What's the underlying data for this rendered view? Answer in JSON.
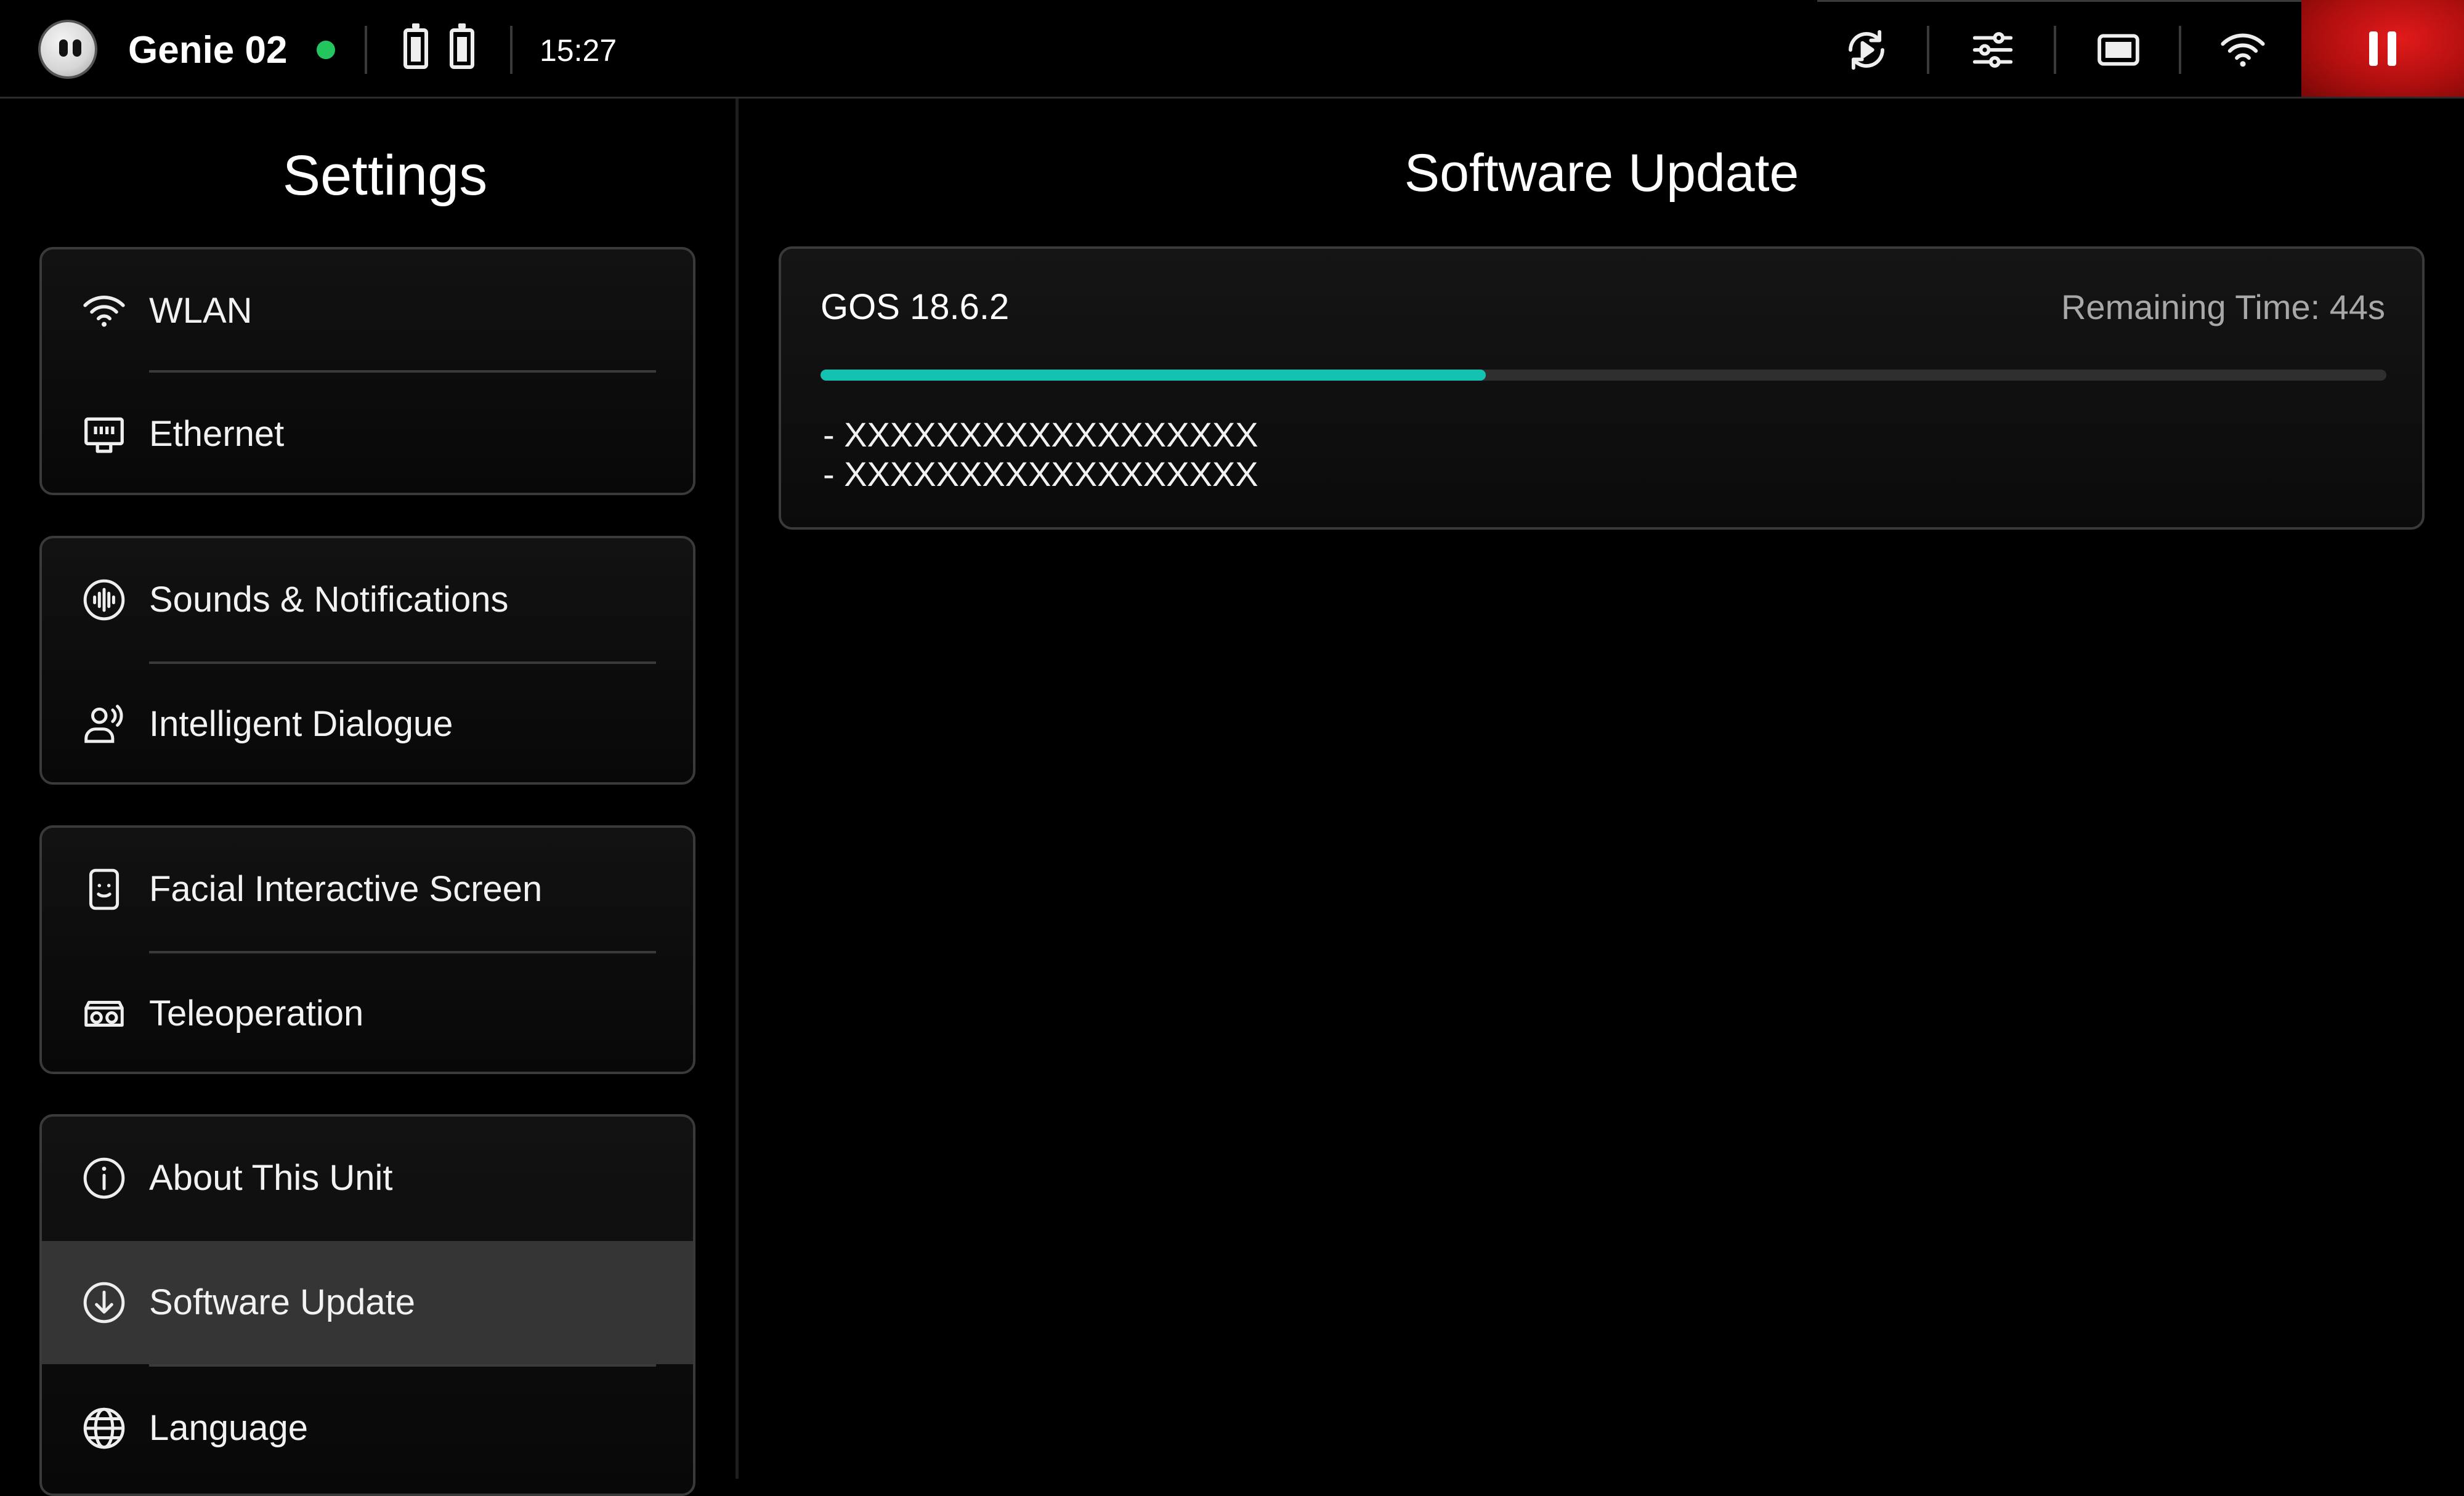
{
  "topbar": {
    "device_name": "Genie 02",
    "time": "15:27",
    "status_color": "#22c55e",
    "icons": [
      "avatar",
      "battery-icon",
      "battery-icon",
      "replay-icon",
      "sliders-icon",
      "screen-icon",
      "wifi-icon",
      "pause-icon"
    ]
  },
  "sidebar": {
    "title": "Settings",
    "groups": [
      {
        "items": [
          {
            "label": "WLAN",
            "icon": "wifi-icon"
          },
          {
            "label": "Ethernet",
            "icon": "ethernet-icon"
          }
        ]
      },
      {
        "items": [
          {
            "label": "Sounds & Notifications",
            "icon": "sound-wave-icon"
          },
          {
            "label": "Intelligent Dialogue",
            "icon": "person-voice-icon"
          }
        ]
      },
      {
        "items": [
          {
            "label": "Facial Interactive Screen",
            "icon": "face-screen-icon"
          },
          {
            "label": "Teleoperation",
            "icon": "vr-headset-icon"
          }
        ]
      },
      {
        "items": [
          {
            "label": "About This Unit",
            "icon": "info-icon"
          },
          {
            "label": "Software Update",
            "icon": "download-icon",
            "selected": true
          },
          {
            "label": "Language",
            "icon": "globe-icon"
          }
        ]
      }
    ]
  },
  "main": {
    "title": "Software Update",
    "update": {
      "version": "GOS 18.6.2",
      "remaining_time": "Remaining Time: 44s",
      "progress": 0.425,
      "accent_color": "#14c2b2",
      "notes": [
        "- XXXXXXXXXXXXXXXXXX",
        "- XXXXXXXXXXXXXXXXXX"
      ]
    }
  }
}
